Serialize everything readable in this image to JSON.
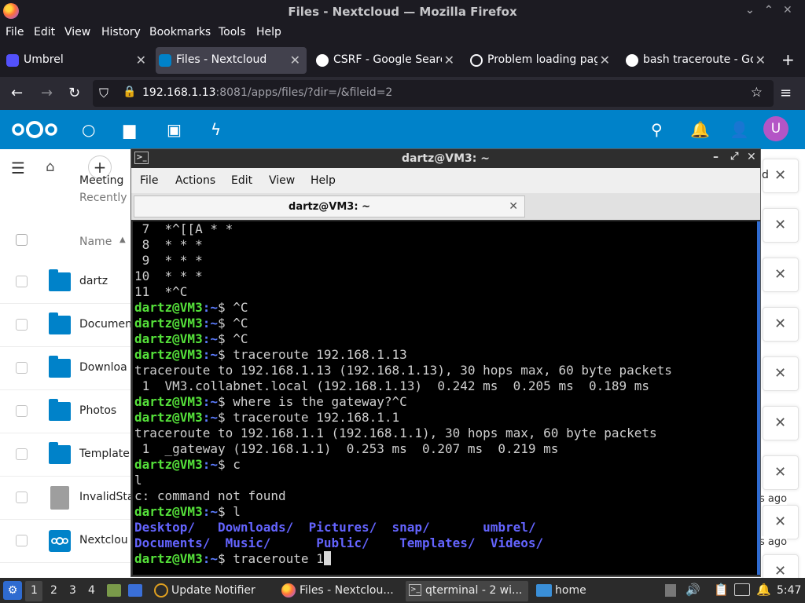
{
  "firefox": {
    "window_title": "Files - Nextcloud — Mozilla Firefox",
    "menu": [
      "File",
      "Edit",
      "View",
      "History",
      "Bookmarks",
      "Tools",
      "Help"
    ],
    "tabs": [
      {
        "label": "Umbrel",
        "icon": "umbrel-icon"
      },
      {
        "label": "Files - Nextcloud",
        "icon": "nextcloud-icon",
        "active": true
      },
      {
        "label": "CSRF - Google Searc",
        "icon": "google-icon"
      },
      {
        "label": "Problem loading pag",
        "icon": "info-icon"
      },
      {
        "label": "bash traceroute - Go",
        "icon": "google-icon"
      }
    ],
    "url_host": "192.168.1.13",
    "url_rest": ":8081/apps/files/?dir=/&fileid=2"
  },
  "nextcloud": {
    "accent": "#0082c9",
    "avatar_letter": "U",
    "recent_title": "Meeting",
    "recent_sub": "Recently",
    "name_header": "Name",
    "files": [
      {
        "name": "dartz",
        "type": "folder"
      },
      {
        "name": "Documen",
        "type": "folder"
      },
      {
        "name": "Downloa",
        "type": "folder"
      },
      {
        "name": "Photos",
        "type": "folder"
      },
      {
        "name": "Template",
        "type": "folder"
      },
      {
        "name": "InvalidSta",
        "type": "file"
      },
      {
        "name": "Nextclou",
        "type": "nextcloud"
      }
    ],
    "right_partial": [
      "d",
      "s ago",
      "s ago"
    ]
  },
  "terminal": {
    "window_title": "dartz@VM3: ~",
    "menu": [
      "File",
      "Actions",
      "Edit",
      "View",
      "Help"
    ],
    "tab_label": "dartz@VM3: ~",
    "prompt_user": "dartz@VM3",
    "prompt_path": ":~",
    "prompt_symbol": "$ ",
    "plain_lines": {
      "l1": " 7  *^[[A * *",
      "l2": " 8  * * *",
      "l3": " 9  * * *",
      "l4": "10  * * *",
      "l5": "11  *^C",
      "l10": "traceroute to 192.168.1.13 (192.168.1.13), 30 hops max, 60 byte packets",
      "l11": " 1  VM3.collabnet.local (192.168.1.13)  0.242 ms  0.205 ms  0.189 ms",
      "l14": "traceroute to 192.168.1.1 (192.168.1.1), 30 hops max, 60 byte packets",
      "l15": " 1  _gateway (192.168.1.1)  0.253 ms  0.207 ms  0.219 ms",
      "l17": "l",
      "l18": "c: command not found"
    },
    "commands": {
      "c6": "^C",
      "c7": "^C",
      "c8": "^C",
      "c9": "traceroute 192.168.1.13",
      "c12": "where is the gateway?^C",
      "c13": "traceroute 192.168.1.1",
      "c16": "c",
      "c19": "l",
      "c22": "traceroute 1"
    },
    "ls_row1": [
      "Desktop/",
      "Downloads/",
      "Pictures/",
      "snap/",
      "umbrel/"
    ],
    "ls_row2": [
      "Documents/",
      "Music/",
      "Public/",
      "Templates/",
      "Videos/"
    ]
  },
  "taskbar": {
    "workspaces": [
      "1",
      "2",
      "3",
      "4"
    ],
    "items": [
      "Update Notifier",
      "Files - Nextclou...",
      "qterminal - 2 wi...",
      "home"
    ],
    "clock": "5:47"
  }
}
